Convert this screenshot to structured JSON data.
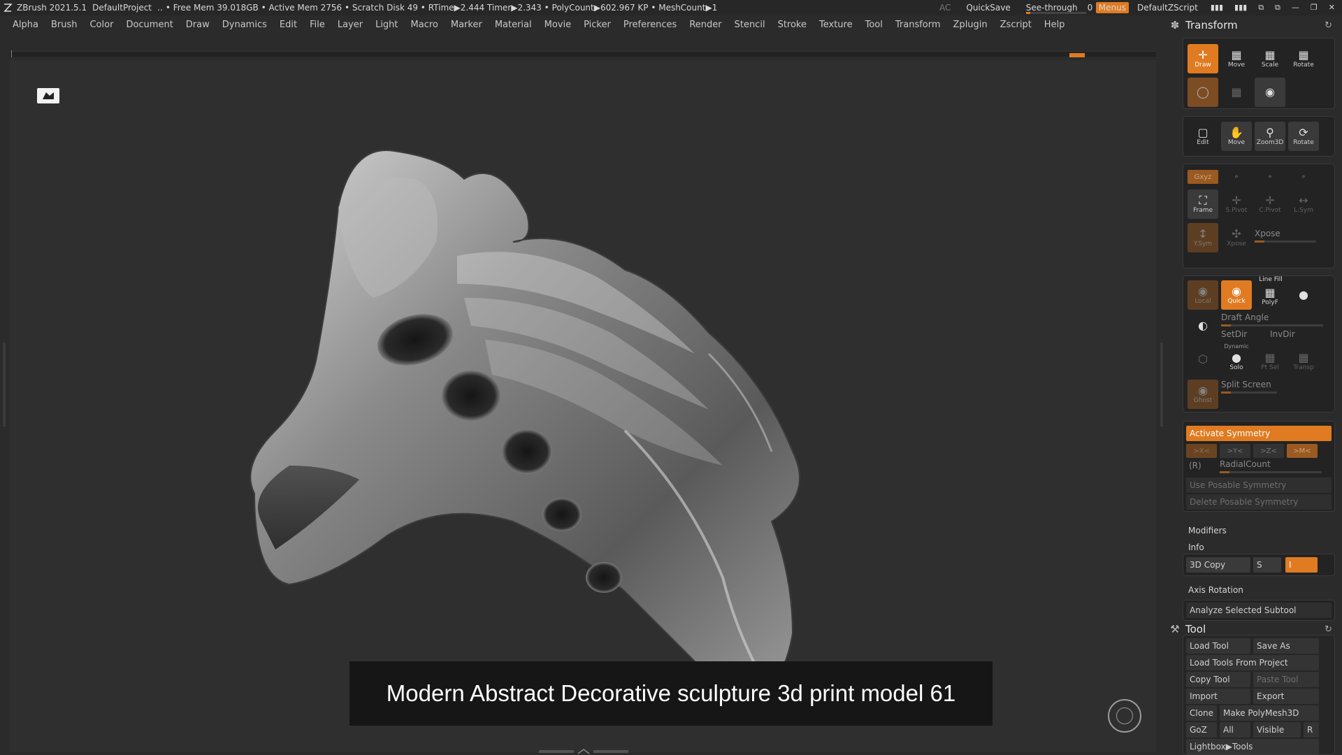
{
  "titlebar": {
    "app": "ZBrush 2021.5.1",
    "project": "DefaultProject",
    "stats": "‥ • Free Mem 39.018GB • Active Mem 2756 • Scratch Disk 49 •  RTime▶2.444 Timer▶2.343 • PolyCount▶602.967 KP  • MeshCount▶1",
    "ac": "AC",
    "quicksave": "QuickSave",
    "see_through_label": "See-through",
    "see_through_value": "0",
    "see_through_fraction": 0,
    "menus": "Menus",
    "script": "DefaultZScript"
  },
  "menubar": [
    "Alpha",
    "Brush",
    "Color",
    "Document",
    "Draw",
    "Dynamics",
    "Edit",
    "File",
    "Layer",
    "Light",
    "Macro",
    "Marker",
    "Material",
    "Movie",
    "Picker",
    "Preferences",
    "Render",
    "Stencil",
    "Stroke",
    "Texture",
    "Tool",
    "Transform",
    "Zplugin",
    "Zscript",
    "Help"
  ],
  "canvas": {
    "caption": "Modern Abstract Decorative sculpture 3d print model 61"
  },
  "transform": {
    "title": "Transform",
    "row1": [
      "Draw",
      "Move",
      "Scale",
      "Rotate"
    ],
    "row3": [
      "Edit",
      "Move",
      "Zoom3D",
      "Rotate"
    ],
    "xyz": "Gxyz",
    "row5": [
      "Frame",
      "S.Pivot",
      "C.Pivot",
      "L.Sym"
    ],
    "row6": [
      "Y.Sym",
      "Xpose"
    ],
    "xpose_label": "Xpose",
    "row7": [
      "Local",
      "Quick",
      "PolyF"
    ],
    "line_fill": "Line Fill",
    "draft_angle": "Draft Angle",
    "setdir": "SetDir",
    "invdir": "InvDir",
    "dynamic": "Dynamic",
    "solo": "Solo",
    "ptsel": "Pt Sel",
    "transp": "Transp",
    "split_screen": "Split Screen",
    "ghost": "Ghost",
    "activate_symmetry": "Activate Symmetry",
    "sym_axes": [
      ">X<",
      ">Y<",
      ">Z<",
      ">M<"
    ],
    "r_label": "(R)",
    "radial_count": "RadialCount",
    "use_posable": "Use Posable Symmetry",
    "delete_posable": "Delete Posable Symmetry",
    "modifiers": "Modifiers",
    "info": "Info",
    "copy3d": "3D Copy",
    "s_label": "S",
    "i_label": "I",
    "axis_rotation": "Axis Rotation",
    "analyze": "Analyze Selected Subtool"
  },
  "tool": {
    "title": "Tool",
    "load_tool": "Load Tool",
    "save_as": "Save As",
    "load_from_project": "Load Tools From Project",
    "copy_tool": "Copy Tool",
    "paste_tool": "Paste Tool",
    "import": "Import",
    "export": "Export",
    "clone": "Clone",
    "make_polymesh": "Make PolyMesh3D",
    "goz": "GoZ",
    "all": "All",
    "visible": "Visible",
    "r": "R",
    "lightbox_tools": "Lightbox▶Tools"
  },
  "colors": {
    "accent": "#e07b21",
    "background": "#2b2b2b",
    "canvas": "#2f2f2f"
  }
}
